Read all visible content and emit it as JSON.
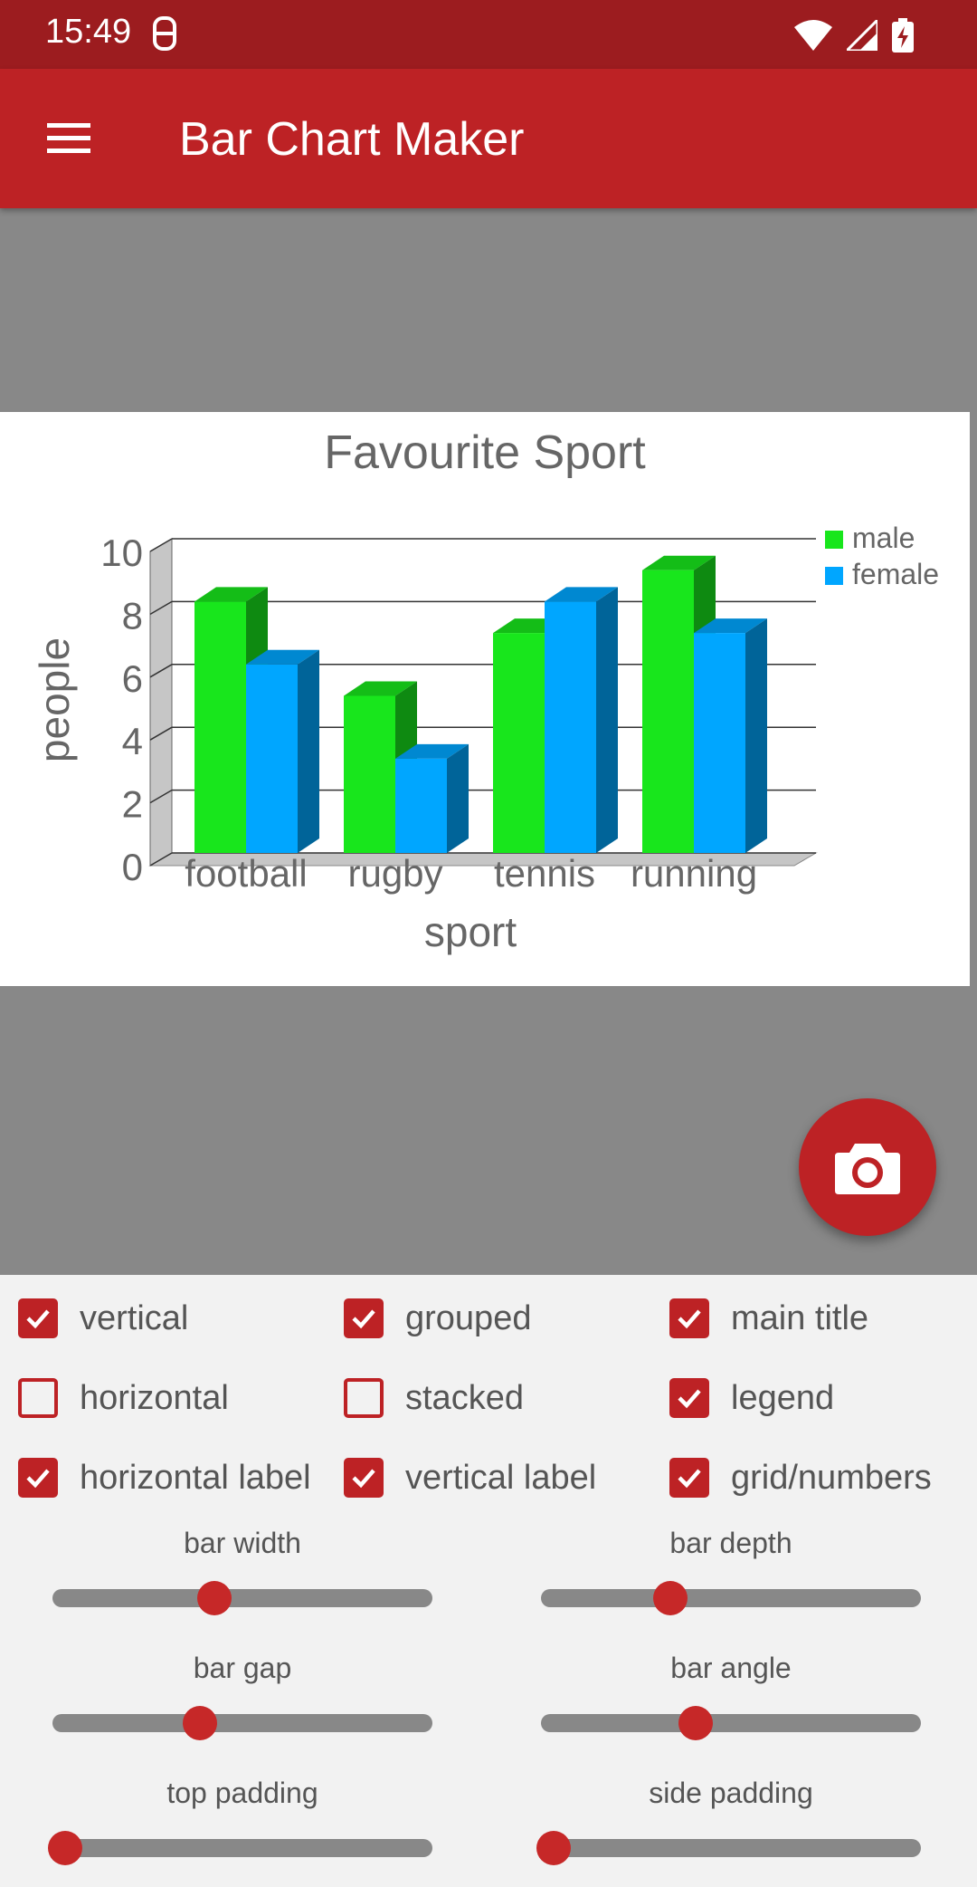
{
  "status_bar": {
    "time": "15:49"
  },
  "app_bar": {
    "title": "Bar Chart Maker",
    "menu_icon": "hamburger-menu-icon"
  },
  "chart_data": {
    "type": "bar",
    "style": "3d-grouped",
    "title": "Favourite Sport",
    "xlabel": "sport",
    "ylabel": "people",
    "ylim": [
      0,
      10
    ],
    "yticks": [
      "0",
      "2",
      "4",
      "6",
      "8",
      "10"
    ],
    "categories": [
      "football",
      "rugby",
      "tennis",
      "running"
    ],
    "series": [
      {
        "name": "male",
        "values": [
          8,
          5,
          7,
          9
        ],
        "color": "#18e61c"
      },
      {
        "name": "female",
        "values": [
          6,
          3,
          8,
          7
        ],
        "color": "#00a6ff"
      }
    ],
    "grid": true,
    "legend": "top-right"
  },
  "fab": {
    "icon": "camera-icon"
  },
  "checkboxes": [
    {
      "label": "vertical",
      "checked": true
    },
    {
      "label": "grouped",
      "checked": true
    },
    {
      "label": "main title",
      "checked": true
    },
    {
      "label": "horizontal",
      "checked": false
    },
    {
      "label": "stacked",
      "checked": false
    },
    {
      "label": "legend",
      "checked": true
    },
    {
      "label": "horizontal label",
      "checked": true
    },
    {
      "label": "vertical label",
      "checked": true
    },
    {
      "label": "grid/numbers",
      "checked": true
    }
  ],
  "sliders": [
    {
      "label": "bar width",
      "value": 0.42
    },
    {
      "label": "bar depth",
      "value": 0.33
    },
    {
      "label": "bar gap",
      "value": 0.38
    },
    {
      "label": "bar angle",
      "value": 0.4
    },
    {
      "label": "top padding",
      "value": 0.0
    },
    {
      "label": "side padding",
      "value": 0.0
    }
  ],
  "colors": {
    "primary": "#bd2225",
    "primary_dark": "#9c1c1f",
    "preview_bg": "#888888"
  }
}
